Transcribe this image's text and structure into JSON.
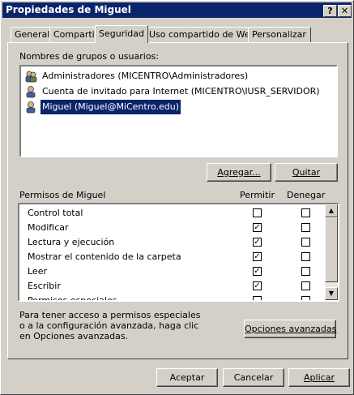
{
  "window": {
    "title": "Propiedades de Miguel",
    "help_btn": "?",
    "close_btn": "✕"
  },
  "tabs": [
    {
      "label": "General"
    },
    {
      "label": "Compartir"
    },
    {
      "label": "Seguridad",
      "active": true
    },
    {
      "label": "Uso compartido de Web"
    },
    {
      "label": "Personalizar"
    }
  ],
  "users": {
    "label": "Nombres de grupos o usuarios:",
    "items": [
      {
        "text": "Administradores (MICENTRO\\Administradores)"
      },
      {
        "text": "Cuenta de invitado para Internet (MICENTRO\\IUSR_SERVIDOR)"
      },
      {
        "text": "Miguel (Miguel@MiCentro.edu)",
        "selected": true
      }
    ],
    "add_button": "Agregar...",
    "remove_button": "Quitar"
  },
  "permissions": {
    "label": "Permisos de Miguel",
    "allow_header": "Permitir",
    "deny_header": "Denegar",
    "rows": [
      {
        "name": "Control total",
        "allow": false,
        "deny": false
      },
      {
        "name": "Modificar",
        "allow": true,
        "deny": false
      },
      {
        "name": "Lectura y ejecución",
        "allow": true,
        "deny": false
      },
      {
        "name": "Mostrar el contenido de la carpeta",
        "allow": true,
        "deny": false
      },
      {
        "name": "Leer",
        "allow": true,
        "deny": false
      },
      {
        "name": "Escribir",
        "allow": true,
        "deny": false
      },
      {
        "name": "Permisos especiales",
        "allow": false,
        "deny": false
      }
    ]
  },
  "advanced": {
    "text_line1": "Para tener acceso a permisos especiales",
    "text_line2": "o a la configuración avanzada, haga clic",
    "text_line3": "en Opciones avanzadas.",
    "button": "Opciones avanzadas"
  },
  "footer": {
    "ok": "Aceptar",
    "cancel": "Cancelar",
    "apply": "Aplicar"
  }
}
